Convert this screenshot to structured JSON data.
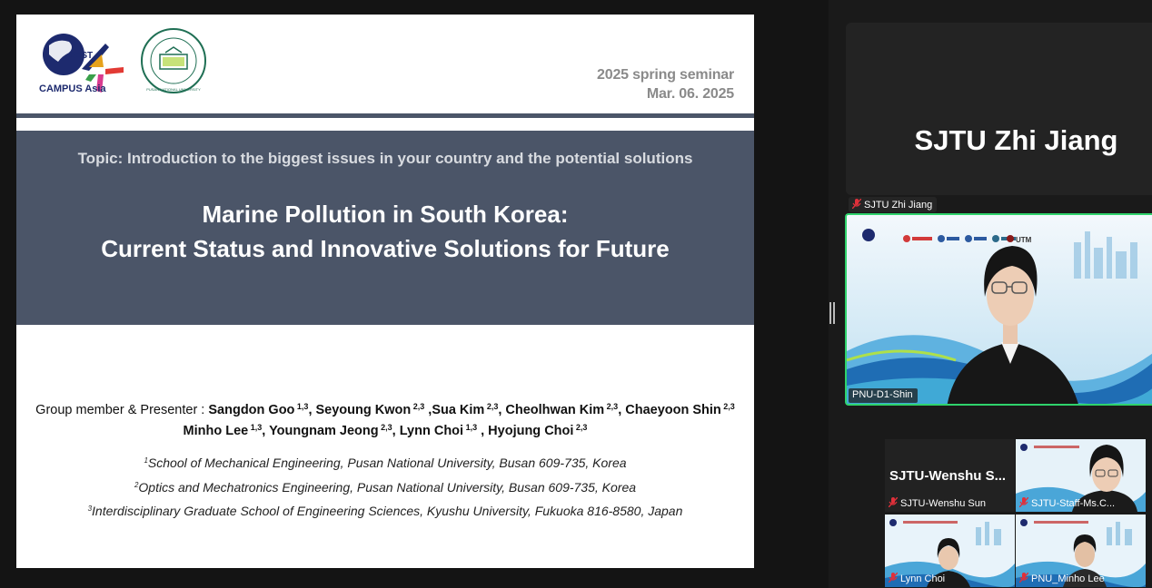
{
  "slide": {
    "logo_text": "EEST",
    "campus_label": "CAMPUS Asia",
    "pnu_logo_text": "PUSAN NATIONAL UNIVERSITY",
    "seminar_line1": "2025 spring seminar",
    "seminar_line2": "Mar. 06. 2025",
    "topic": "Topic: Introduction to the biggest issues in your country and the potential solutions",
    "title_line1": "Marine Pollution in South Korea:",
    "title_line2": "Current Status and Innovative Solutions for Future",
    "members_label": "Group member & Presenter  :",
    "members_line1": [
      {
        "name": "Sangdon Goo",
        "sup": "1,3",
        "sep": ", "
      },
      {
        "name": "Seyoung Kwon",
        "sup": "2,3",
        "sep": " ,"
      },
      {
        "name": "Sua Kim",
        "sup": "2,3",
        "sep": ", "
      },
      {
        "name": "Cheolhwan Kim",
        "sup": "2,3",
        "sep": ", "
      },
      {
        "name": "Chaeyoon Shin",
        "sup": "2,3",
        "sep": ""
      }
    ],
    "members_line2": [
      {
        "name": "Minho Lee",
        "sup": "1,3",
        "sep": ", "
      },
      {
        "name": "Youngnam Jeong",
        "sup": "2,3",
        "sep": ", "
      },
      {
        "name": "Lynn Choi",
        "sup": "1,3",
        "sep": " , "
      },
      {
        "name": "Hyojung Choi",
        "sup": "2,3",
        "sep": ""
      }
    ],
    "affiliations": [
      {
        "sup": "1",
        "text": "School of Mechanical Engineering, Pusan National University, Busan 609-735, Korea"
      },
      {
        "sup": "2",
        "text": "Optics and Mechatronics Engineering, Pusan National University, Busan 609-735, Korea"
      },
      {
        "sup": "3",
        "text": "Interdisciplinary Graduate School of Engineering Sciences, Kyushu University, Fukuoka 816-8580, Japan"
      }
    ]
  },
  "participants": {
    "featured": {
      "display_name": "SJTU Zhi Jiang",
      "label": "SJTU Zhi Jiang",
      "muted": true
    },
    "active_speaker": {
      "label": "PNU-D1-Shin",
      "banner_text": "UTM"
    },
    "gallery": [
      {
        "display_name": "SJTU-Wenshu  S...",
        "label": "SJTU-Wenshu Sun",
        "muted": true,
        "video": false
      },
      {
        "label": "SJTU-Staff-Ms.C...",
        "muted": true,
        "video": true
      },
      {
        "label": "Lynn Choi",
        "muted": true,
        "video": true
      },
      {
        "label": "PNU_Minho Lee",
        "muted": true,
        "video": true
      }
    ]
  },
  "colors": {
    "slide_header_bar": "#4b5568",
    "active_speaker_border": "#2fd36c",
    "mute_icon": "#e0303a",
    "logo_blue": "#1d2a6e"
  },
  "icons": {
    "mute": "microphone-muted-icon"
  }
}
